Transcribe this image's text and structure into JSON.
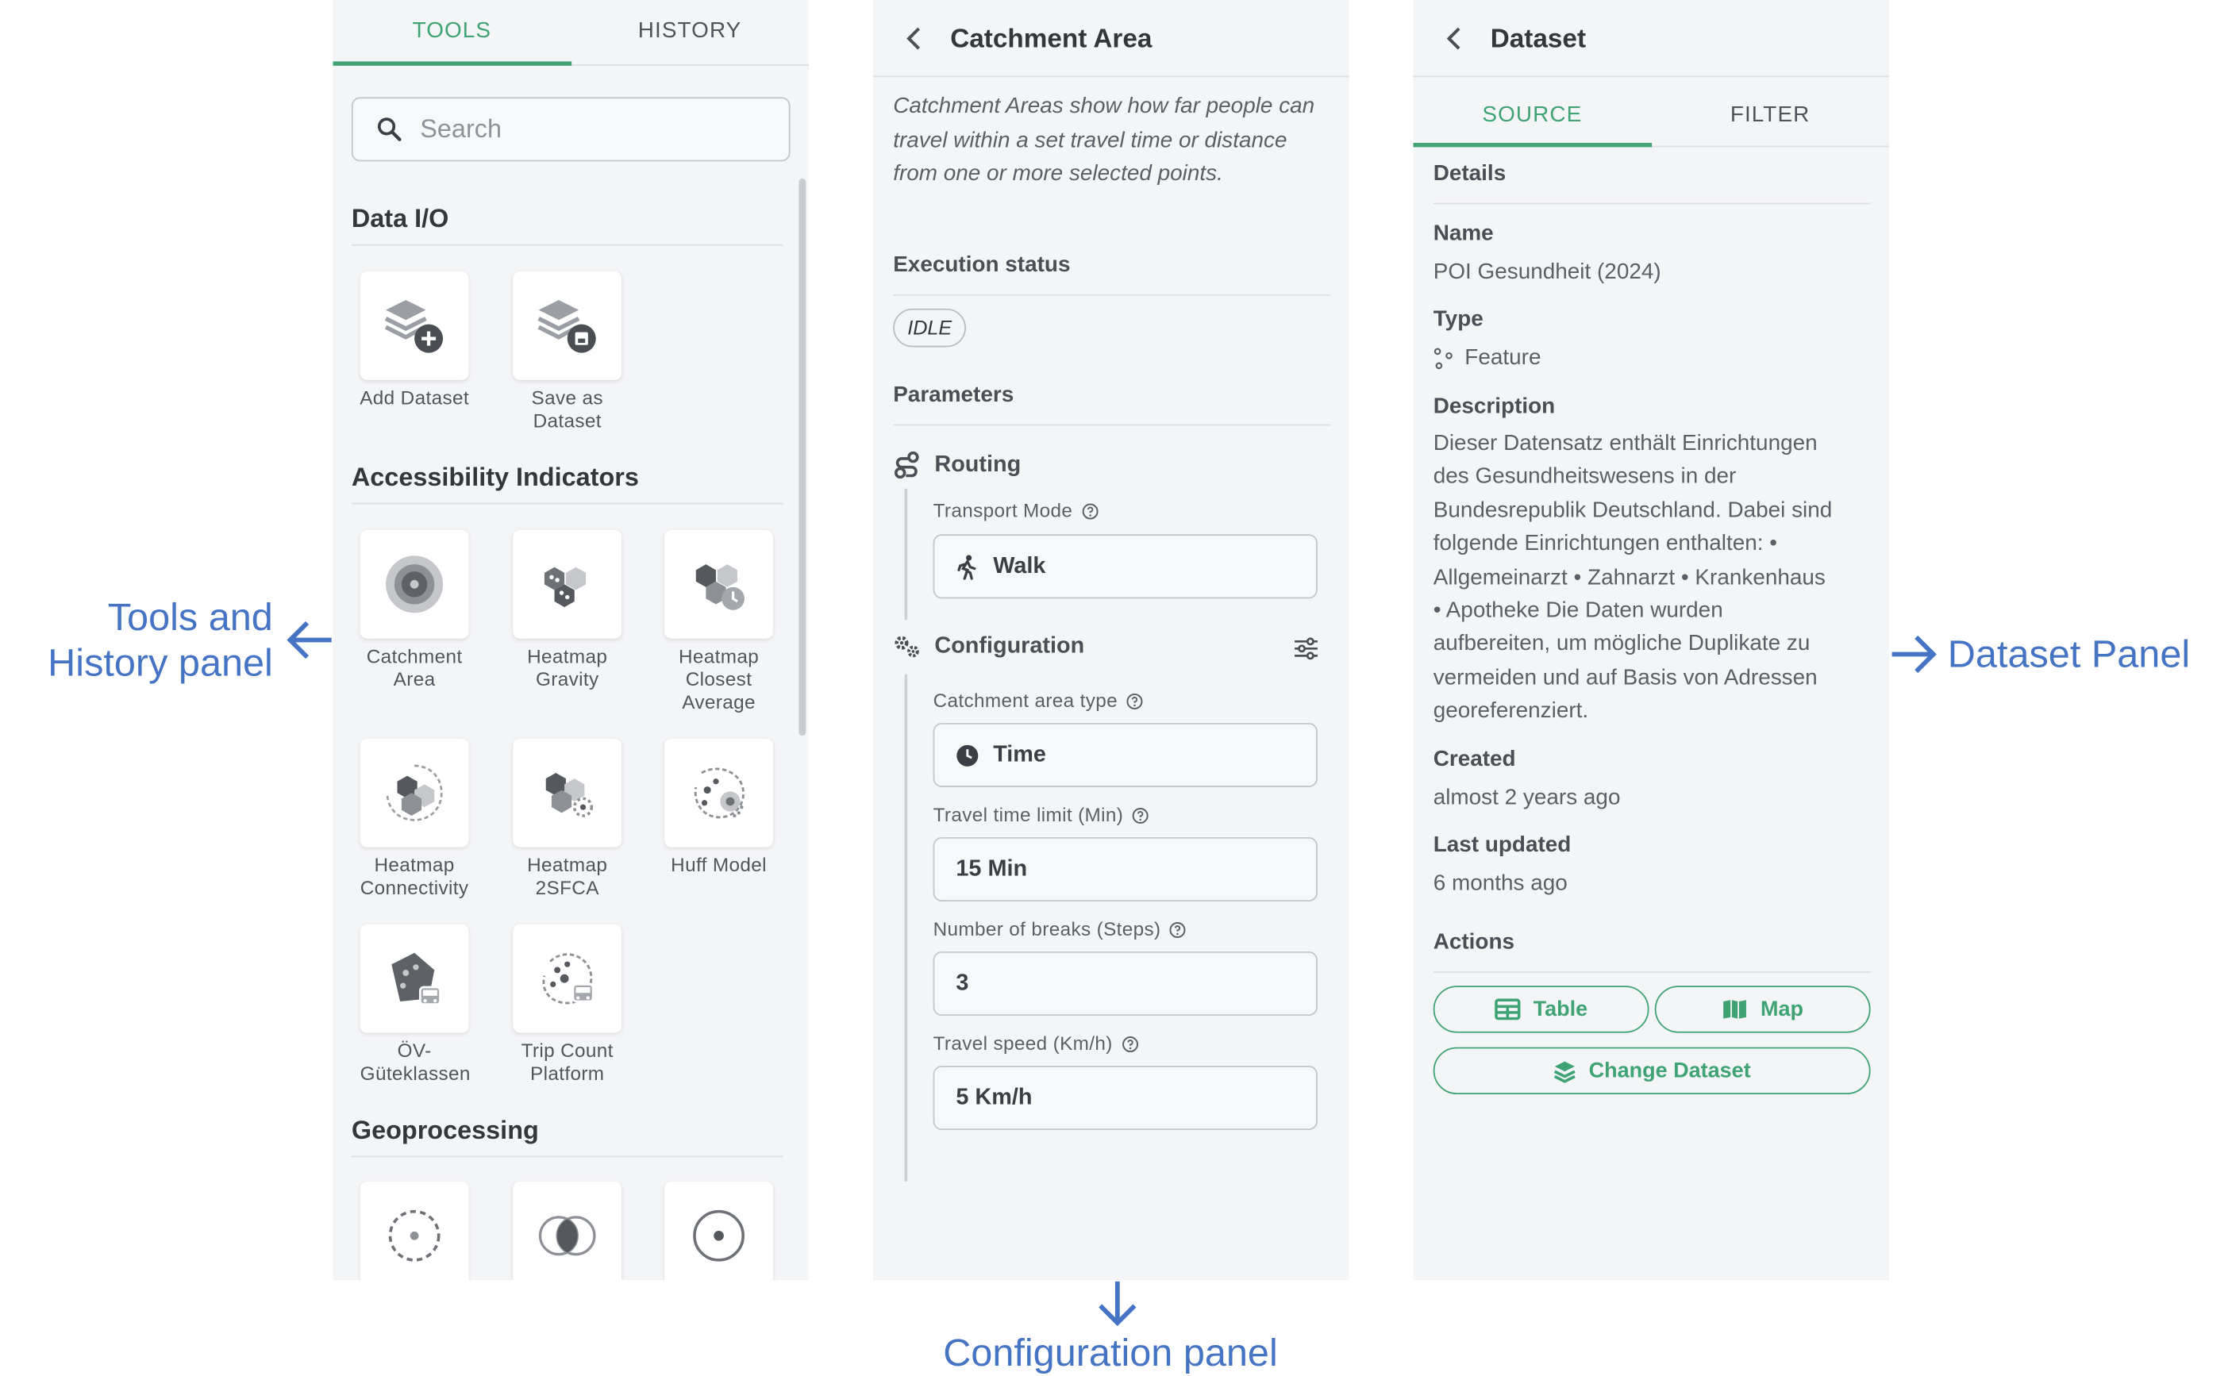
{
  "tools_panel": {
    "tabs": [
      "TOOLS",
      "HISTORY"
    ],
    "active_tab": "TOOLS",
    "search": {
      "placeholder": "Search"
    },
    "sections": [
      {
        "title": "Data I/O",
        "tools": [
          {
            "label": "Add Dataset",
            "icon": "layers-add-icon"
          },
          {
            "label": "Save as Dataset",
            "icon": "layers-save-icon"
          }
        ]
      },
      {
        "title": "Accessibility Indicators",
        "tools": [
          {
            "label": "Catchment Area",
            "icon": "catchment-area-icon"
          },
          {
            "label": "Heatmap Gravity",
            "icon": "heatmap-gravity-icon"
          },
          {
            "label": "Heatmap Closest Average",
            "icon": "heatmap-closest-average-icon"
          },
          {
            "label": "Heatmap Connectivity",
            "icon": "heatmap-connectivity-icon"
          },
          {
            "label": "Heatmap 2SFCA",
            "icon": "heatmap-2sfca-icon"
          },
          {
            "label": "Huff Model",
            "icon": "huff-model-icon"
          },
          {
            "label": "ÖV-Güteklassen",
            "icon": "ov-gueteklassen-icon"
          },
          {
            "label": "Trip Count Platform",
            "icon": "trip-count-icon"
          }
        ]
      },
      {
        "title": "Geoprocessing",
        "tools": [
          {
            "label": "",
            "icon": "buffer-icon"
          },
          {
            "label": "",
            "icon": "intersect-icon"
          },
          {
            "label": "",
            "icon": "centroid-icon"
          }
        ]
      }
    ]
  },
  "config_panel": {
    "title": "Catchment Area",
    "description": "Catchment Areas show how far people can travel within a set travel time or distance from one or more selected points.",
    "execution_status_label": "Execution status",
    "status": "IDLE",
    "parameters_label": "Parameters",
    "routing": {
      "title": "Routing",
      "transport_mode_label": "Transport Mode",
      "transport_mode_value": "Walk"
    },
    "configuration": {
      "title": "Configuration",
      "catchment_type_label": "Catchment area type",
      "catchment_type_value": "Time",
      "time_limit_label": "Travel time limit (Min)",
      "time_limit_value": "15 Min",
      "breaks_label": "Number of breaks (Steps)",
      "breaks_value": "3",
      "speed_label": "Travel speed (Km/h)",
      "speed_value": "5 Km/h"
    }
  },
  "dataset_panel": {
    "title": "Dataset",
    "tabs": [
      "SOURCE",
      "FILTER"
    ],
    "active_tab": "SOURCE",
    "details_label": "Details",
    "name_label": "Name",
    "name_value": "POI Gesundheit (2024)",
    "type_label": "Type",
    "type_value": "Feature",
    "description_label": "Description",
    "description_lines": [
      "Dieser Datensatz enthält Einrichtungen",
      "des Gesundheitswesens in der",
      "Bundesrepublik Deutschland. Dabei sind",
      "folgende Einrichtungen enthalten: •",
      "Allgemeinarzt • Zahnarzt • Krankenhaus",
      "• Apotheke Die Daten wurden",
      "aufbereiten, um mögliche Duplikate zu",
      "vermeiden und auf Basis von Adressen",
      "georeferenziert."
    ],
    "created_label": "Created",
    "created_value": "almost 2 years ago",
    "updated_label": "Last updated",
    "updated_value": "6 months ago",
    "actions_label": "Actions",
    "buttons": {
      "table": "Table",
      "map": "Map",
      "change": "Change Dataset"
    }
  },
  "annotations": {
    "tools_line1": "Tools and",
    "tools_line2": "History panel",
    "dataset": "Dataset Panel",
    "config": "Configuration panel"
  },
  "colors": {
    "accent": "#3fa374",
    "annotation": "#4674c4",
    "panel_bg": "#f4f5f7"
  }
}
